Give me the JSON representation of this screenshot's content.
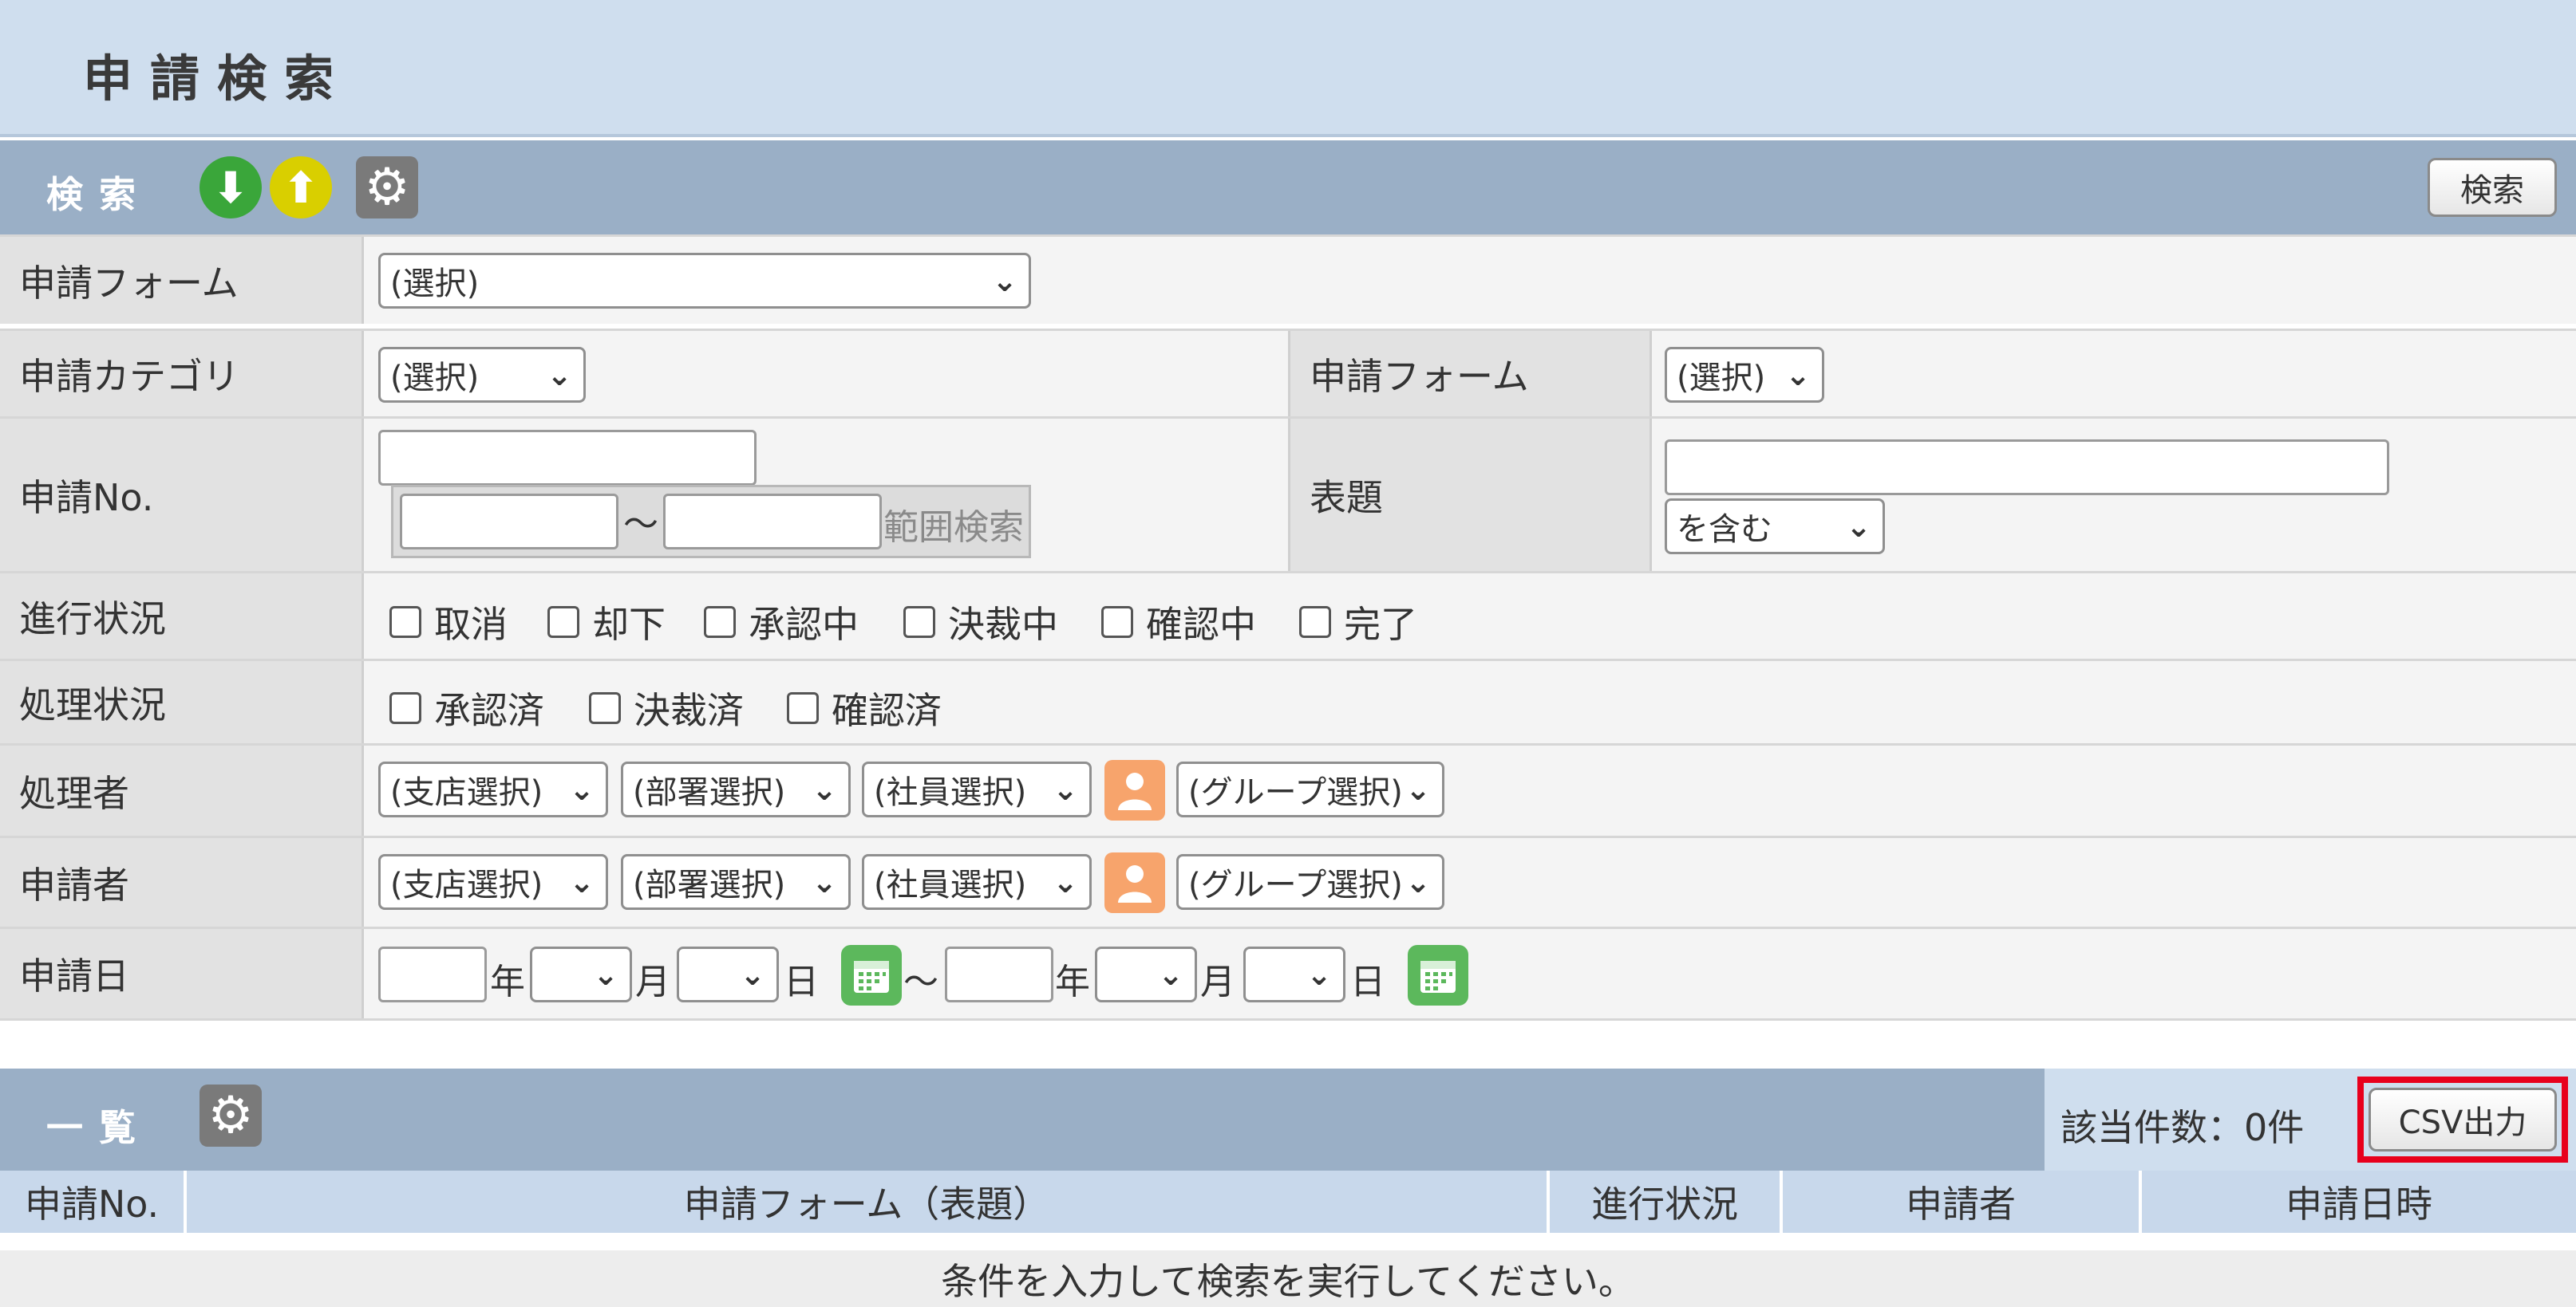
{
  "page": {
    "title": "申請検索"
  },
  "search": {
    "bar_title": "検索",
    "search_button": "検索",
    "form_label": "申請フォーム",
    "form_select": "(選択)",
    "category_label": "申請カテゴリ",
    "category_select": "(選択)",
    "form2_label": "申請フォーム",
    "form2_select": "(選択)",
    "no_label": "申請No.",
    "range_tilde": "〜",
    "range_label": "範囲検索",
    "subject_label": "表題",
    "subject_match": "を含む",
    "progress_label": "進行状況",
    "progress_options": [
      "取消",
      "却下",
      "承認中",
      "決裁中",
      "確認中",
      "完了"
    ],
    "process_label": "処理状況",
    "process_options": [
      "承認済",
      "決裁済",
      "確認済"
    ],
    "handler_label": "処理者",
    "applicant_label": "申請者",
    "branch_select": "(支店選択)",
    "dept_select": "(部署選択)",
    "employee_select": "(社員選択)",
    "group_select": "(グループ選択)",
    "date_label": "申請日",
    "year_unit": "年",
    "month_unit": "月",
    "day_unit": "日",
    "date_tilde": "〜"
  },
  "list": {
    "bar_title": "一覧",
    "count_text": "該当件数：0件",
    "csv_button": "CSV出力",
    "columns": [
      "申請No.",
      "申請フォーム（表題）",
      "進行状況",
      "申請者",
      "申請日時"
    ],
    "empty_message": "条件を入力して検索を実行してください。"
  },
  "icons": {
    "down": "arrow-down-icon",
    "up": "arrow-up-icon",
    "gear": "gear-icon",
    "person": "person-icon",
    "calendar": "calendar-icon"
  },
  "colors": {
    "header_bg": "#cfdeee",
    "bar_bg": "#9aafc6",
    "highlight": "#e8001c",
    "green": "#3aa63a",
    "yellow": "#d9cf00"
  }
}
